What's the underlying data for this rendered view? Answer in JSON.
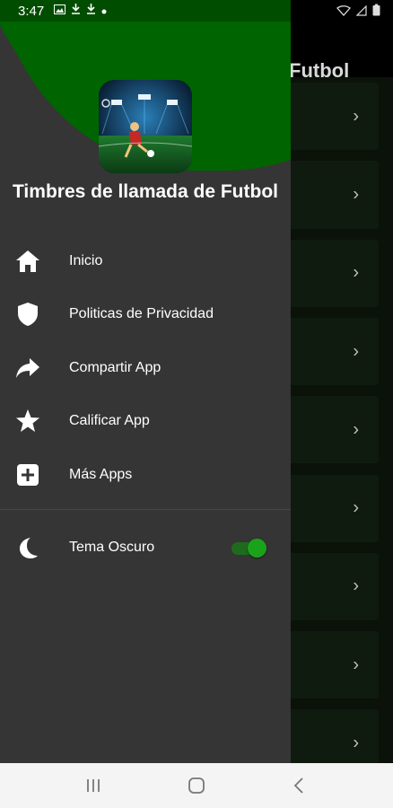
{
  "status_bar": {
    "time": "3:47",
    "left_icons": [
      "image-icon",
      "download-icon",
      "download-icon",
      "dot-icon"
    ],
    "right_icons": [
      "wifi-icon",
      "signal-icon",
      "battery-icon"
    ]
  },
  "background_app": {
    "title": "Futbol",
    "row_count": 9,
    "chevron": "›"
  },
  "drawer": {
    "app_name": "Timbres de llamada de Futbol",
    "logo_icon": "soccer-stadium-logo",
    "menu": [
      {
        "id": "inicio",
        "label": "Inicio",
        "icon": "home-icon"
      },
      {
        "id": "privacy",
        "label": "Politicas de Privacidad",
        "icon": "shield-icon"
      },
      {
        "id": "share",
        "label": "Compartir App",
        "icon": "share-icon"
      },
      {
        "id": "rate",
        "label": "Calificar App",
        "icon": "star-icon"
      },
      {
        "id": "more",
        "label": "Más Apps",
        "icon": "plus-box-icon"
      }
    ],
    "dark_theme": {
      "label": "Tema Oscuro",
      "enabled": true,
      "icon": "moon-icon"
    }
  },
  "nav_bar": {
    "buttons": [
      "recents-icon",
      "home-icon",
      "back-icon"
    ]
  },
  "colors": {
    "drawer_bg": "#353535",
    "header_green": "#006400",
    "accent_green": "#1aa31a"
  }
}
